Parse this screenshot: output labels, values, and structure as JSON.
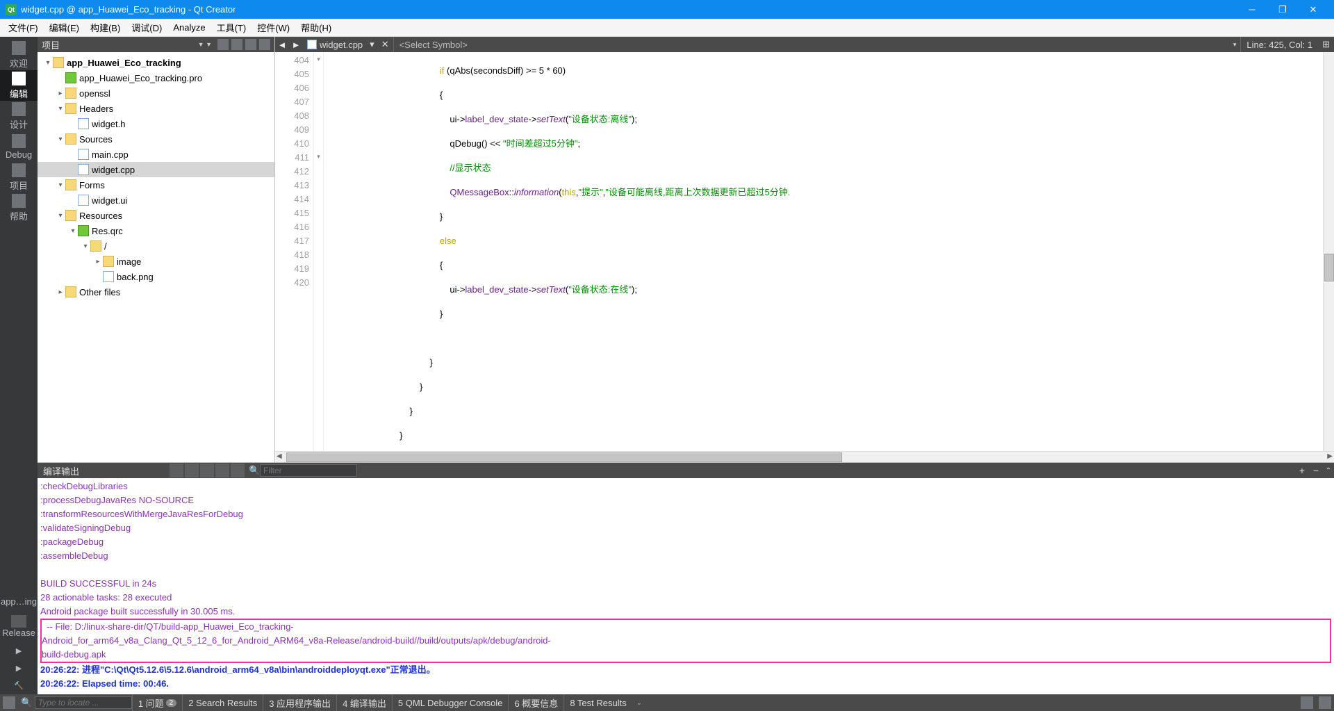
{
  "window": {
    "title": "widget.cpp @ app_Huawei_Eco_tracking - Qt Creator"
  },
  "menu": {
    "items": [
      "文件(F)",
      "编辑(E)",
      "构建(B)",
      "调试(D)",
      "Analyze",
      "工具(T)",
      "控件(W)",
      "帮助(H)"
    ]
  },
  "leftbar": {
    "items": [
      "欢迎",
      "编辑",
      "设计",
      "Debug",
      "项目",
      "帮助"
    ],
    "bottom": [
      "app…ing",
      "Release"
    ]
  },
  "project": {
    "title": "项目",
    "tree": [
      {
        "d": 0,
        "chev": "▾",
        "icon": "folder",
        "lbl": "app_Huawei_Eco_tracking",
        "bold": true
      },
      {
        "d": 1,
        "chev": "",
        "icon": "qt",
        "lbl": "app_Huawei_Eco_tracking.pro"
      },
      {
        "d": 1,
        "chev": "▸",
        "icon": "folder",
        "lbl": "openssl"
      },
      {
        "d": 1,
        "chev": "▾",
        "icon": "folder",
        "lbl": "Headers"
      },
      {
        "d": 2,
        "chev": "",
        "icon": "file",
        "lbl": "widget.h"
      },
      {
        "d": 1,
        "chev": "▾",
        "icon": "folder",
        "lbl": "Sources"
      },
      {
        "d": 2,
        "chev": "",
        "icon": "file",
        "lbl": "main.cpp"
      },
      {
        "d": 2,
        "chev": "",
        "icon": "file",
        "lbl": "widget.cpp",
        "sel": true
      },
      {
        "d": 1,
        "chev": "▾",
        "icon": "folder",
        "lbl": "Forms"
      },
      {
        "d": 2,
        "chev": "",
        "icon": "file",
        "lbl": "widget.ui"
      },
      {
        "d": 1,
        "chev": "▾",
        "icon": "folder",
        "lbl": "Resources"
      },
      {
        "d": 2,
        "chev": "▾",
        "icon": "qt",
        "lbl": "Res.qrc"
      },
      {
        "d": 3,
        "chev": "▾",
        "icon": "folder",
        "lbl": "/"
      },
      {
        "d": 4,
        "chev": "▸",
        "icon": "folder",
        "lbl": "image"
      },
      {
        "d": 4,
        "chev": "",
        "icon": "file",
        "lbl": "back.png"
      },
      {
        "d": 1,
        "chev": "▸",
        "icon": "folder",
        "lbl": "Other files"
      }
    ]
  },
  "editor": {
    "file": "widget.cpp",
    "symbol": "<Select Symbol>",
    "linecol": "Line: 425, Col: 1",
    "gutter": [
      "404",
      "405",
      "406",
      "407",
      "408",
      "409",
      "410",
      "411",
      "412",
      "413",
      "414",
      "415",
      "416",
      "417",
      "418",
      "419",
      "420"
    ],
    "fold": [
      "▾",
      "",
      "",
      "",
      "",
      "",
      "",
      "▾",
      "",
      "",
      "",
      "",
      "",
      "",
      "",
      "",
      ""
    ]
  },
  "code": {
    "l0_a": "                                            ",
    "l0_if": "if",
    "l0_b": " (",
    "l0_fn": "qAbs",
    "l0_c": "(secondsDiff) >= ",
    "l0_n1": "5",
    "l0_d": " * ",
    "l0_n2": "60",
    "l0_e": ")",
    "l1": "                                            {",
    "l2_a": "                                                ui->",
    "l2_b": "label_dev_state",
    "l2_c": "->",
    "l2_m": "setText",
    "l2_d": "(",
    "l2_s": "\"设备状态:离线\"",
    "l2_e": ");",
    "l3_a": "                                                ",
    "l3_fn": "qDebug",
    "l3_b": "() << ",
    "l3_s": "\"时间差超过5分钟\"",
    "l3_c": ";",
    "l4_a": "                                                ",
    "l4_c": "//显示状态",
    "l5_a": "                                                ",
    "l5_t": "QMessageBox",
    "l5_b": "::",
    "l5_m": "information",
    "l5_c": "(",
    "l5_k": "this",
    "l5_d": ",",
    "l5_s1": "\"提示\"",
    "l5_e": ",",
    "l5_s2": "\"设备可能离线,距离上次数据更新已超过5分钟.",
    "l5_f": "",
    "l6": "                                            }",
    "l7_a": "                                            ",
    "l7_k": "else",
    "l8": "                                            {",
    "l9_a": "                                                ui->",
    "l9_b": "label_dev_state",
    "l9_c": "->",
    "l9_m": "setText",
    "l9_d": "(",
    "l9_s": "\"设备状态:在线\"",
    "l9_e": ");",
    "l10": "                                            }",
    "l11": "",
    "l12": "                                        }",
    "l13": "                                    }",
    "l14": "                                }",
    "l15": "                            }",
    "l16": "                        }"
  },
  "output": {
    "title": "编译输出",
    "filter": "Filter",
    "lines": [
      {
        "t": ":checkDebugLibraries",
        "c": "purple"
      },
      {
        "t": ":processDebugJavaRes NO-SOURCE",
        "c": "purple"
      },
      {
        "t": ":transformResourcesWithMergeJavaResForDebug",
        "c": "purple"
      },
      {
        "t": ":validateSigningDebug",
        "c": "purple"
      },
      {
        "t": ":packageDebug",
        "c": "purple"
      },
      {
        "t": ":assembleDebug",
        "c": "purple"
      },
      {
        "t": "",
        "c": ""
      },
      {
        "t": "BUILD SUCCESSFUL in 24s",
        "c": "purple"
      },
      {
        "t": "28 actionable tasks: 28 executed",
        "c": "purple"
      },
      {
        "t": "Android package built successfully in 30.005 ms.",
        "c": "purple"
      }
    ],
    "boxed": "  -- File: D:/linux-share-dir/QT/build-app_Huawei_Eco_tracking-\nAndroid_for_arm64_v8a_Clang_Qt_5_12_6_for_Android_ARM64_v8a-Release/android-build//build/outputs/apk/debug/android-\nbuild-debug.apk",
    "after": [
      {
        "t": "20:26:22: 进程\"C:\\Qt\\Qt5.12.6\\5.12.6\\android_arm64_v8a\\bin\\androiddeployqt.exe\"正常退出。",
        "c": "blue"
      },
      {
        "t": "20:26:22: Elapsed time: 00:46.",
        "c": "blue"
      }
    ]
  },
  "status": {
    "loc_ph": "Type to locate ...",
    "tabs": [
      "1 问题",
      "2 Search Results",
      "3 应用程序输出",
      "4 编译输出",
      "5 QML Debugger Console",
      "6 概要信息",
      "8 Test Results"
    ],
    "badge": "2"
  }
}
